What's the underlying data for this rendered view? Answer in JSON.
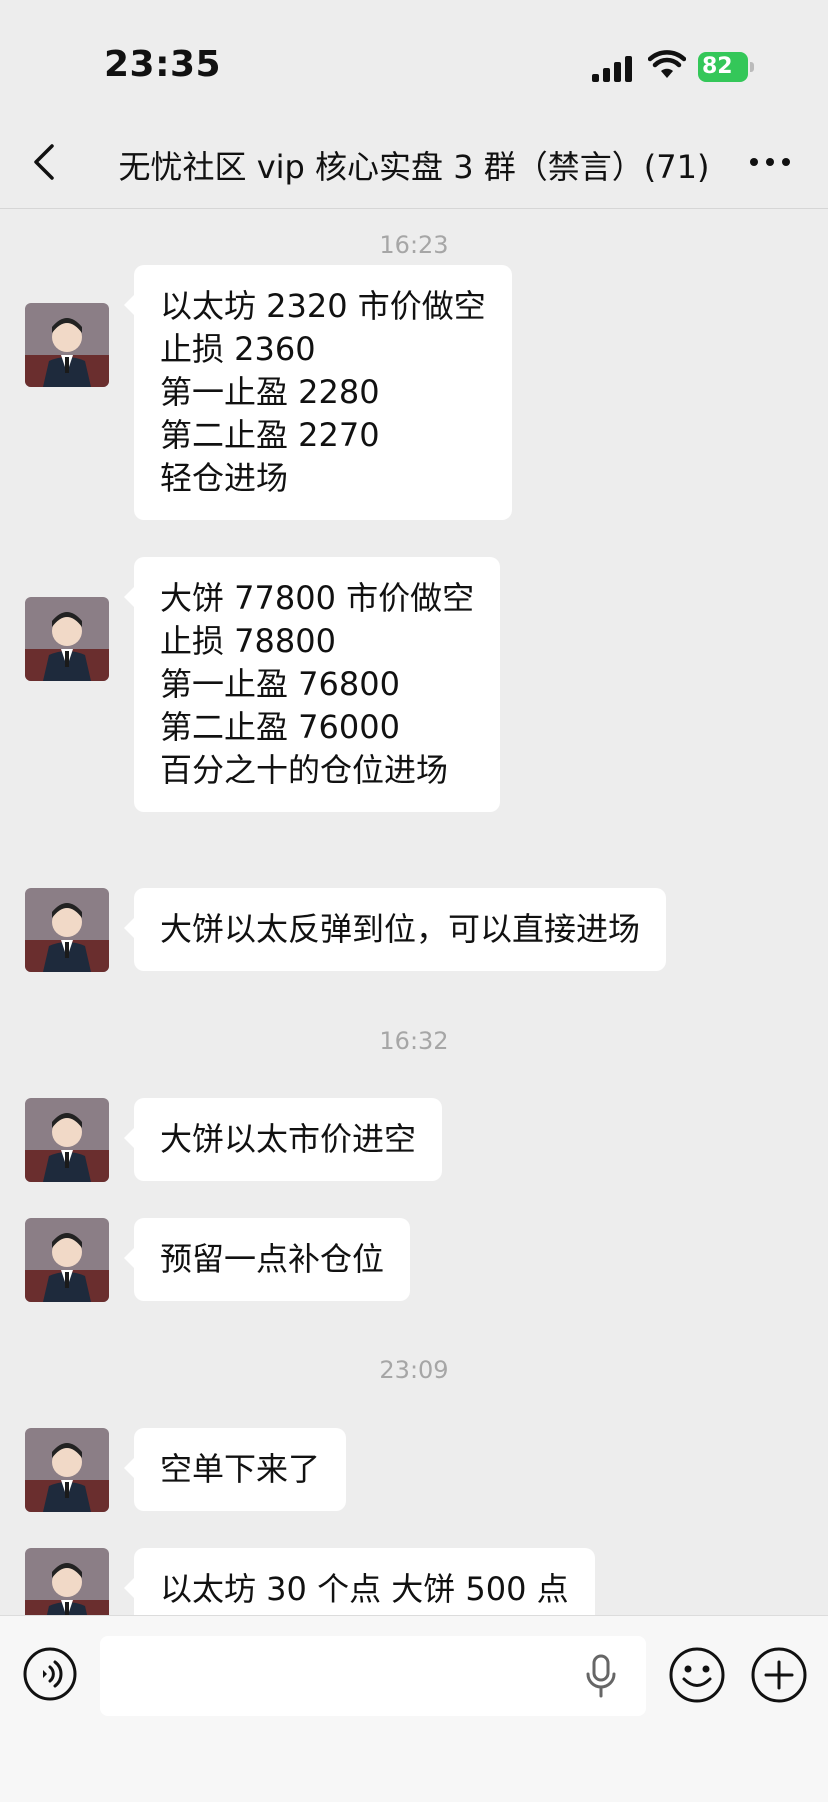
{
  "status": {
    "time": "23:35",
    "battery": "82"
  },
  "nav": {
    "title": "无忧社区 vip 核心实盘 3 群（禁言）(71)"
  },
  "messages": [
    {
      "timestamp": "16:23"
    },
    {
      "lines": [
        "以太坊 2320 市价做空",
        "止损 2360",
        "第一止盈 2280",
        "第二止盈 2270",
        "轻仓进场"
      ]
    },
    {
      "lines": [
        "大饼 77800 市价做空",
        "止损 78800",
        "第一止盈 76800",
        "第二止盈 76000",
        "百分之十的仓位进场"
      ]
    },
    {
      "lines": [
        "大饼以太反弹到位，可以直接进场"
      ]
    },
    {
      "timestamp": "16:32"
    },
    {
      "lines": [
        "大饼以太市价进空"
      ]
    },
    {
      "lines": [
        "预留一点补仓位"
      ]
    },
    {
      "timestamp": "23:09"
    },
    {
      "lines": [
        "空单下来了"
      ]
    },
    {
      "lines": [
        "以太坊 30 个点 大饼 500 点"
      ]
    }
  ],
  "input": {
    "placeholder": ""
  },
  "icons": {
    "back": "chevron-left-icon",
    "more": "more-horizontal-icon",
    "voice": "voice-icon",
    "mic": "microphone-icon",
    "emoji": "emoji-icon",
    "plus": "plus-icon"
  },
  "colors": {
    "background": "#ededed",
    "bubble": "#ffffff",
    "battery": "#34c759",
    "timestamp": "#a6a6a6"
  }
}
